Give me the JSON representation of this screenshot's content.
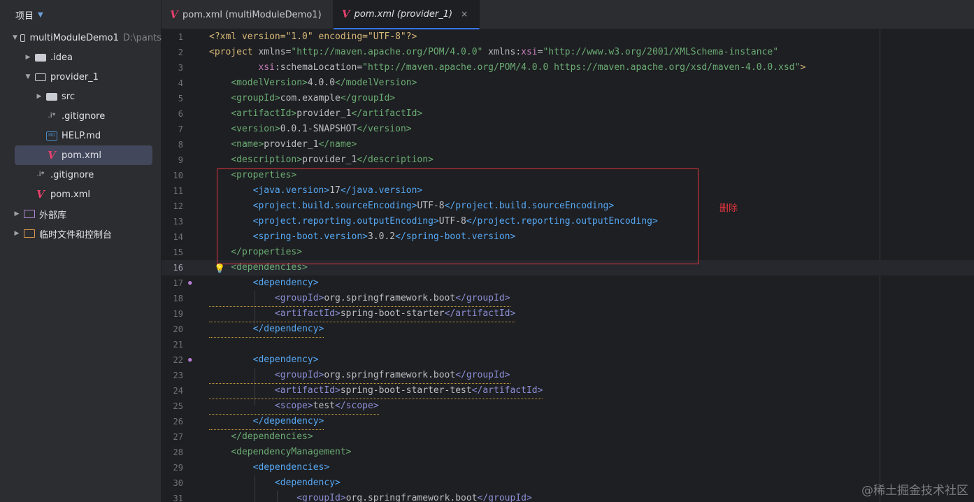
{
  "sidebar": {
    "title": "项目",
    "tree": [
      {
        "label": "multiModuleDemo1",
        "hint": "D:\\pants"
      },
      {
        "label": ".idea"
      },
      {
        "label": "provider_1"
      },
      {
        "label": "src"
      },
      {
        "label": ".gitignore"
      },
      {
        "label": "HELP.md"
      },
      {
        "label": "pom.xml"
      },
      {
        "label": ".gitignore"
      },
      {
        "label": "pom.xml"
      },
      {
        "label": "外部库"
      },
      {
        "label": "临时文件和控制台"
      }
    ]
  },
  "tabs": [
    {
      "label": "pom.xml (multiModuleDemo1)"
    },
    {
      "label": "pom.xml (provider_1)",
      "close": "×"
    }
  ],
  "editor": {
    "current_line": 16,
    "annotation": "删除",
    "lines": [
      {
        "n": "1"
      },
      {
        "n": "2"
      },
      {
        "n": "3"
      },
      {
        "n": "4"
      },
      {
        "n": "5"
      },
      {
        "n": "6"
      },
      {
        "n": "7"
      },
      {
        "n": "8"
      },
      {
        "n": "9"
      },
      {
        "n": "10"
      },
      {
        "n": "11"
      },
      {
        "n": "12"
      },
      {
        "n": "13"
      },
      {
        "n": "14"
      },
      {
        "n": "15"
      },
      {
        "n": "16"
      },
      {
        "n": "17"
      },
      {
        "n": "18"
      },
      {
        "n": "19"
      },
      {
        "n": "20"
      },
      {
        "n": "21"
      },
      {
        "n": "22"
      },
      {
        "n": "23"
      },
      {
        "n": "24"
      },
      {
        "n": "25"
      },
      {
        "n": "26"
      },
      {
        "n": "27"
      },
      {
        "n": "28"
      },
      {
        "n": "29"
      },
      {
        "n": "30"
      },
      {
        "n": "31"
      }
    ]
  },
  "code": {
    "l1": [
      "<?xml version=\"1.0\" encoding=\"UTF-8\"?>"
    ],
    "l2a": "<project ",
    "l2b": "xmlns",
    "l2c": "=",
    "l2d": "\"http://maven.apache.org/POM/4.0.0\"",
    "l2e": " xmlns:",
    "l2f": "xsi",
    "l2g": "=",
    "l2h": "\"http://www.w3.org/2001/XMLSchema-instance\"",
    "l3a": "xsi",
    "l3b": ":schemaLocation",
    "l3c": "=",
    "l3d": "\"http://maven.apache.org/POM/4.0.0 https://maven.apache.org/xsd/maven-4.0.0.xsd\"",
    "l3e": ">",
    "modelVersion": "4.0.0",
    "groupId": "com.example",
    "artifactId": "provider_1",
    "version": "0.0.1-SNAPSHOT",
    "name": "provider_1",
    "description": "provider_1",
    "java_version": "17",
    "source_encoding": "UTF-8",
    "output_encoding": "UTF-8",
    "boot_version": "3.0.2",
    "dep1_group": "org.springframework.boot",
    "dep1_artifact": "spring-boot-starter",
    "dep2_group": "org.springframework.boot",
    "dep2_artifact": "spring-boot-starter-test",
    "dep2_scope": "test",
    "dep3_group": "org.springframework.boot"
  },
  "watermark": "@稀土掘金技术社区",
  "colors": {
    "annotation": "#e0343f",
    "maven": "#e4406b",
    "tab_accent": "#3574f0"
  }
}
